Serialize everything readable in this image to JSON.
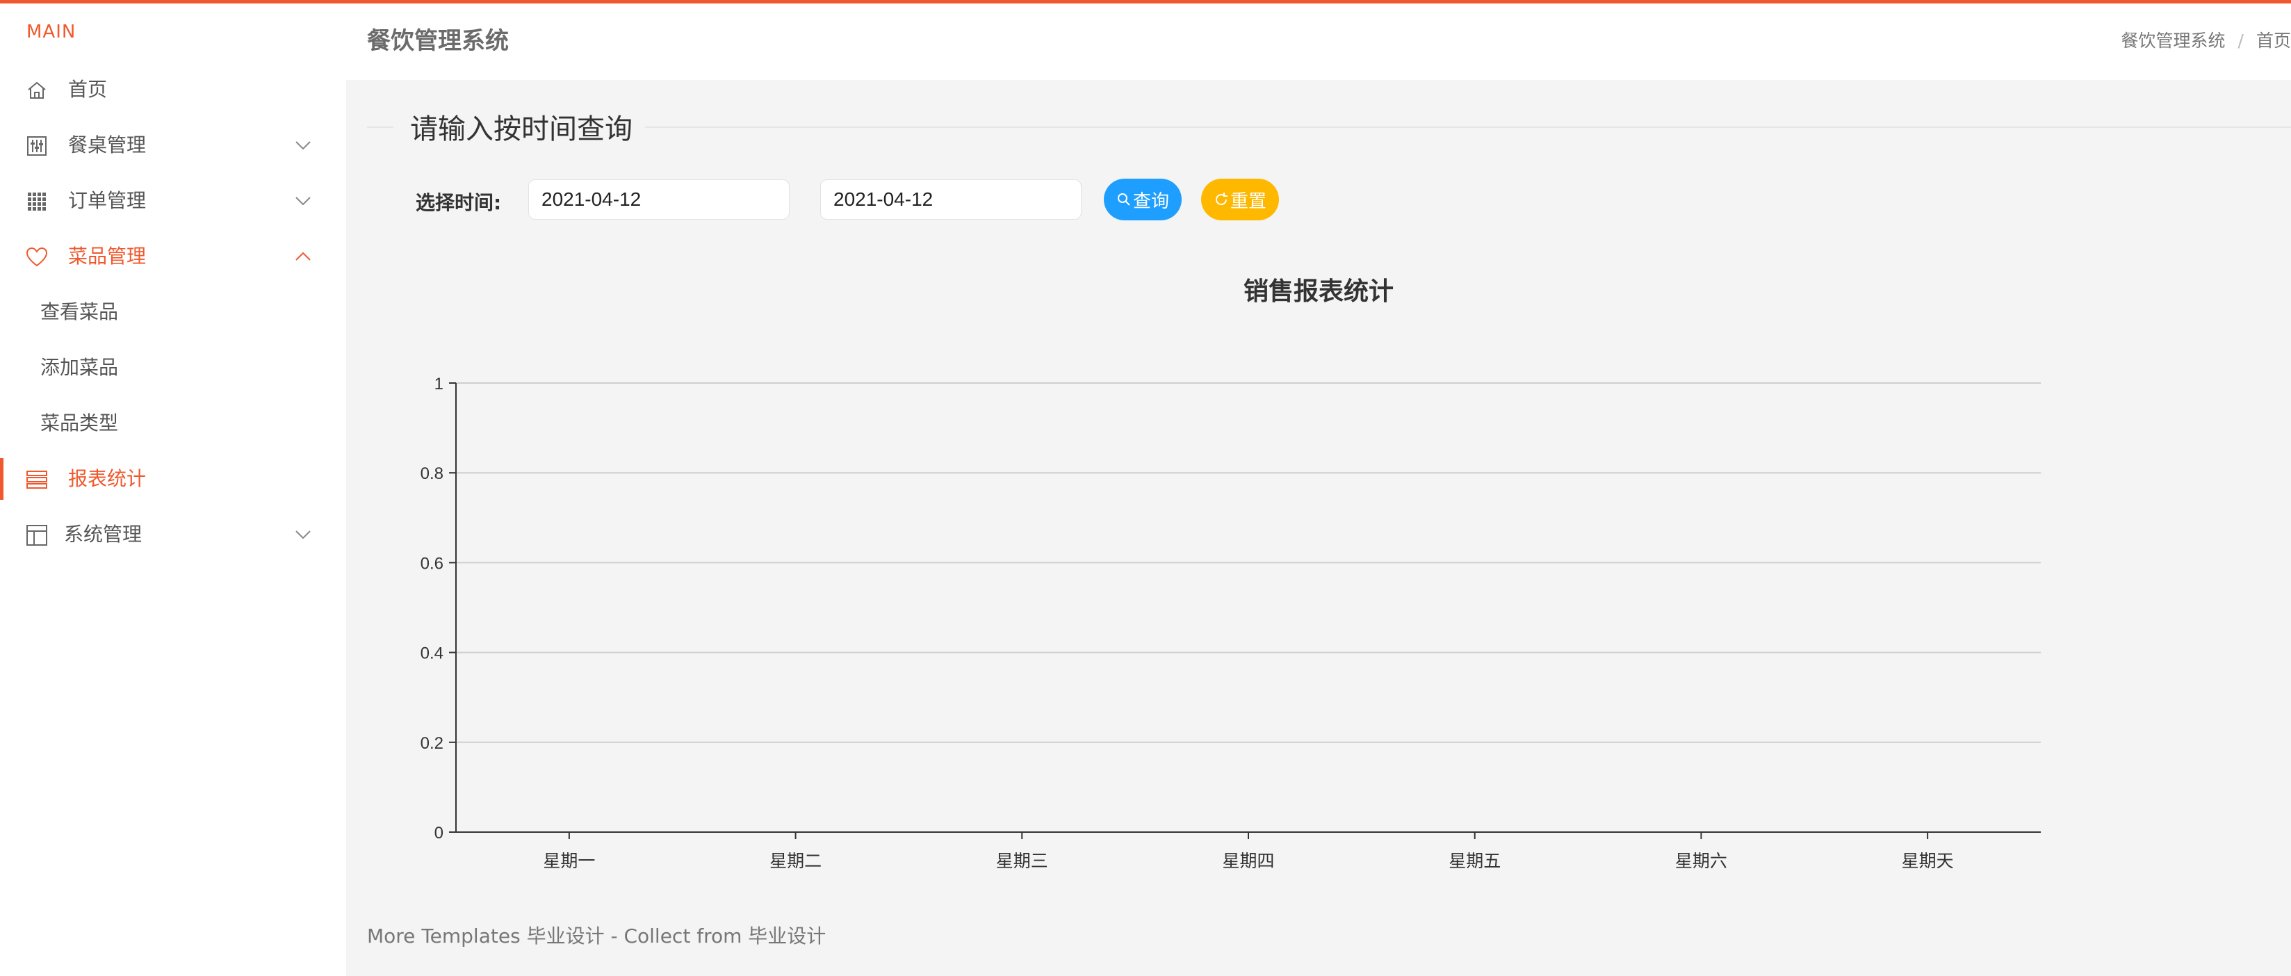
{
  "brand": "MAIN",
  "sidebar": {
    "items": [
      {
        "label": "首页"
      },
      {
        "label": "餐桌管理"
      },
      {
        "label": "订单管理"
      },
      {
        "label": "菜品管理",
        "children": [
          "查看菜品",
          "添加菜品",
          "菜品类型"
        ]
      },
      {
        "label": "报表统计"
      },
      {
        "label": "系统管理"
      }
    ]
  },
  "header": {
    "title": "餐饮管理系统",
    "breadcrumb": [
      "餐饮管理系统",
      "首页"
    ]
  },
  "filter": {
    "legend": "请输入按时间查询",
    "time_label": "选择时间:",
    "start_date": "2021-04-12",
    "end_date": "2021-04-12",
    "search_label": "查询",
    "reset_label": "重置"
  },
  "chart_data": {
    "type": "bar",
    "title": "销售报表统计",
    "categories": [
      "星期一",
      "星期二",
      "星期三",
      "星期四",
      "星期五",
      "星期六",
      "星期天"
    ],
    "values": [],
    "ylim": [
      0,
      1
    ],
    "yticks": [
      "0",
      "0.2",
      "0.4",
      "0.6",
      "0.8",
      "1"
    ],
    "grid": true
  },
  "footer": "More Templates 毕业设计 - Collect from 毕业设计",
  "colors": {
    "accent": "#f0592e",
    "search_button": "#1e9fff",
    "reset_button": "#ffb800"
  }
}
